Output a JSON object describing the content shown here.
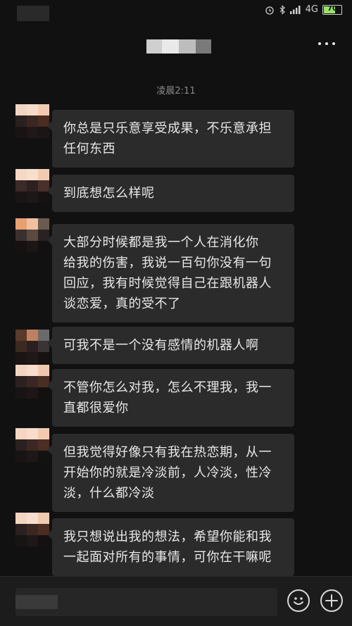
{
  "header": {
    "more_icon": "more-dots-icon"
  },
  "status_bar": {
    "network": "4G",
    "battery": "70",
    "battery_level": 0.7
  },
  "chat": {
    "timestamp": "凌晨2:11",
    "messages": [
      {
        "lines": [
          "你总是只乐意享受成果，不乐意承担",
          "任何东西"
        ]
      },
      {
        "lines": [
          "到底想怎么样呢"
        ]
      },
      {
        "lines": [
          "大部分时候都是我一个人在消化你",
          "给我的伤害，我说一百句你没有一句",
          "回应，我有时候觉得自己在跟机器人",
          "谈恋爱，真的受不了"
        ]
      },
      {
        "lines": [
          "可我不是一个没有感情的机器人啊"
        ]
      },
      {
        "lines": [
          "不管你怎么对我，怎么不理我，我一",
          "直都很爱你"
        ]
      },
      {
        "lines": [
          "但我觉得好像只有我在热恋期，从一",
          "开始你的就是冷淡前，人冷淡，性冷",
          "淡，什么都冷淡"
        ]
      },
      {
        "lines": [
          "我只想说出我的想法，希望你能和我",
          "一起面对所有的事情，可你在干嘛呢"
        ]
      }
    ]
  },
  "input_bar": {
    "emoji_icon": "emoji-icon",
    "plus_icon": "plus-icon"
  },
  "colors": {
    "background": "#111111",
    "bubble": "#2b2b2b",
    "text": "#e8e8e8",
    "timestamp": "#8a8a8a"
  }
}
